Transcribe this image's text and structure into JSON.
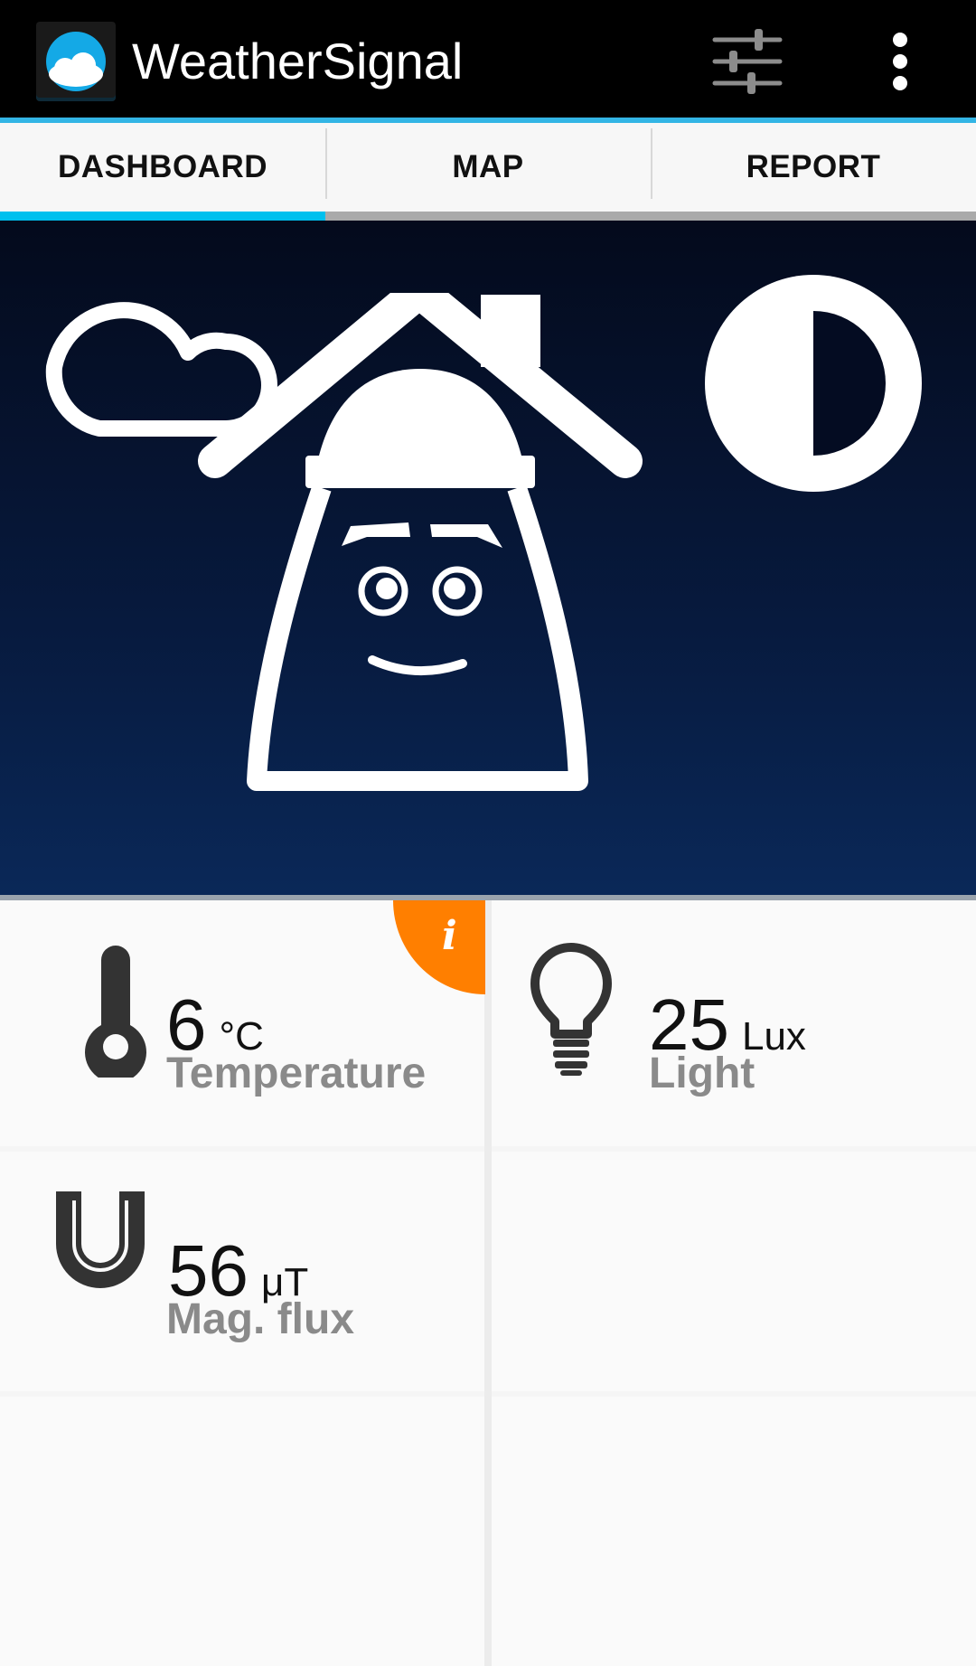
{
  "app": {
    "title": "WeatherSignal",
    "icon": "cloud-app-icon"
  },
  "actionbar": {
    "settings_icon": "sliders-icon",
    "overflow_icon": "overflow-menu-icon"
  },
  "tabs": [
    {
      "label": "DASHBOARD",
      "active": true
    },
    {
      "label": "MAP",
      "active": false
    },
    {
      "label": "REPORT",
      "active": false
    }
  ],
  "hero": {
    "weather_icon": "cloud-icon",
    "moon_icon": "half-moon-icon",
    "character": "house-mascot-illustration"
  },
  "sensors": [
    {
      "value": "6",
      "unit": "°C",
      "label": "Temperature",
      "icon": "thermometer-icon",
      "info": "i"
    },
    {
      "value": "25",
      "unit": "Lux",
      "label": "Light",
      "icon": "lightbulb-icon"
    },
    {
      "value": "56",
      "unit": "μT",
      "label": "Mag. flux",
      "icon": "magnet-icon"
    }
  ],
  "colors": {
    "accent": "#33b5e5",
    "tab_indicator": "#00c0ee",
    "info_badge": "#ff7f00",
    "hero_top": "#040a1c",
    "hero_bottom": "#0a2858"
  }
}
